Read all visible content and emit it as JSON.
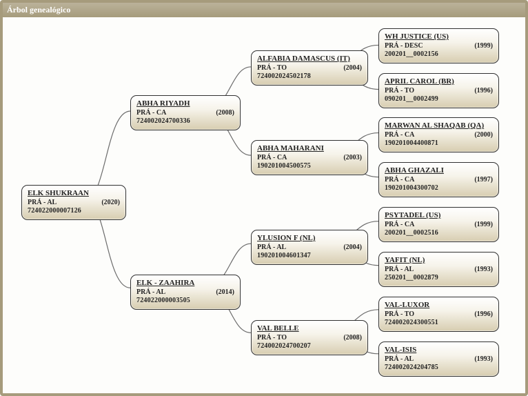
{
  "title": "Árbol genealógico",
  "nodes": {
    "root": {
      "name": "ELK SHUKRAAN",
      "breed": "PRÁ - AL",
      "year": "(2020)",
      "code": "724022000007126"
    },
    "s": {
      "name": "ABHA RIYADH",
      "breed": "PRÁ - CA",
      "year": "(2008)",
      "code": "724002024700336"
    },
    "d": {
      "name": "ELK - ZAAHIRA",
      "breed": "PRÁ - AL",
      "year": "(2014)",
      "code": "724022000003505"
    },
    "ss": {
      "name": "ALFABIA DAMASCUS (IT)",
      "breed": "PRÁ - TO",
      "year": "(2004)",
      "code": "724002024502178"
    },
    "sd": {
      "name": "ABHA MAHARANI",
      "breed": "PRÁ - CA",
      "year": "(2003)",
      "code": "190201004500575"
    },
    "ds": {
      "name": "YLUSION F (NL)",
      "breed": "PRÁ - AL",
      "year": "(2004)",
      "code": "190201004601347"
    },
    "dd": {
      "name": "VAL BELLE",
      "breed": "PRÁ - TO",
      "year": "(2008)",
      "code": "724002024700207"
    },
    "sss": {
      "name": "WH JUSTICE (US)",
      "breed": "PRÁ - DESC",
      "year": "(1999)",
      "code": "200201__0002156"
    },
    "ssd": {
      "name": "APRIL CAROL (BR)",
      "breed": "PRÁ - TO",
      "year": "(1996)",
      "code": "090201__0002499"
    },
    "sds": {
      "name": "MARWAN AL SHAQAB (QA)",
      "breed": "PRÁ - CA",
      "year": "(2000)",
      "code": "190201004400871"
    },
    "sdd": {
      "name": "ABHA GHAZALI",
      "breed": "PRÁ - CA",
      "year": "(1997)",
      "code": "190201004300702"
    },
    "dss": {
      "name": "PSYTADEL (US)",
      "breed": "PRÁ - CA",
      "year": "(1999)",
      "code": "200201__0002516"
    },
    "dsd": {
      "name": "YAFIT (NL)",
      "breed": "PRÁ - AL",
      "year": "(1993)",
      "code": "250201__0002879"
    },
    "dds": {
      "name": "VAL-LUXOR",
      "breed": "PRÁ - TO",
      "year": "(1996)",
      "code": "724002024300551"
    },
    "ddd": {
      "name": "VAL-ISIS",
      "breed": "PRÁ - AL",
      "year": "(1993)",
      "code": "724002024204785"
    }
  }
}
